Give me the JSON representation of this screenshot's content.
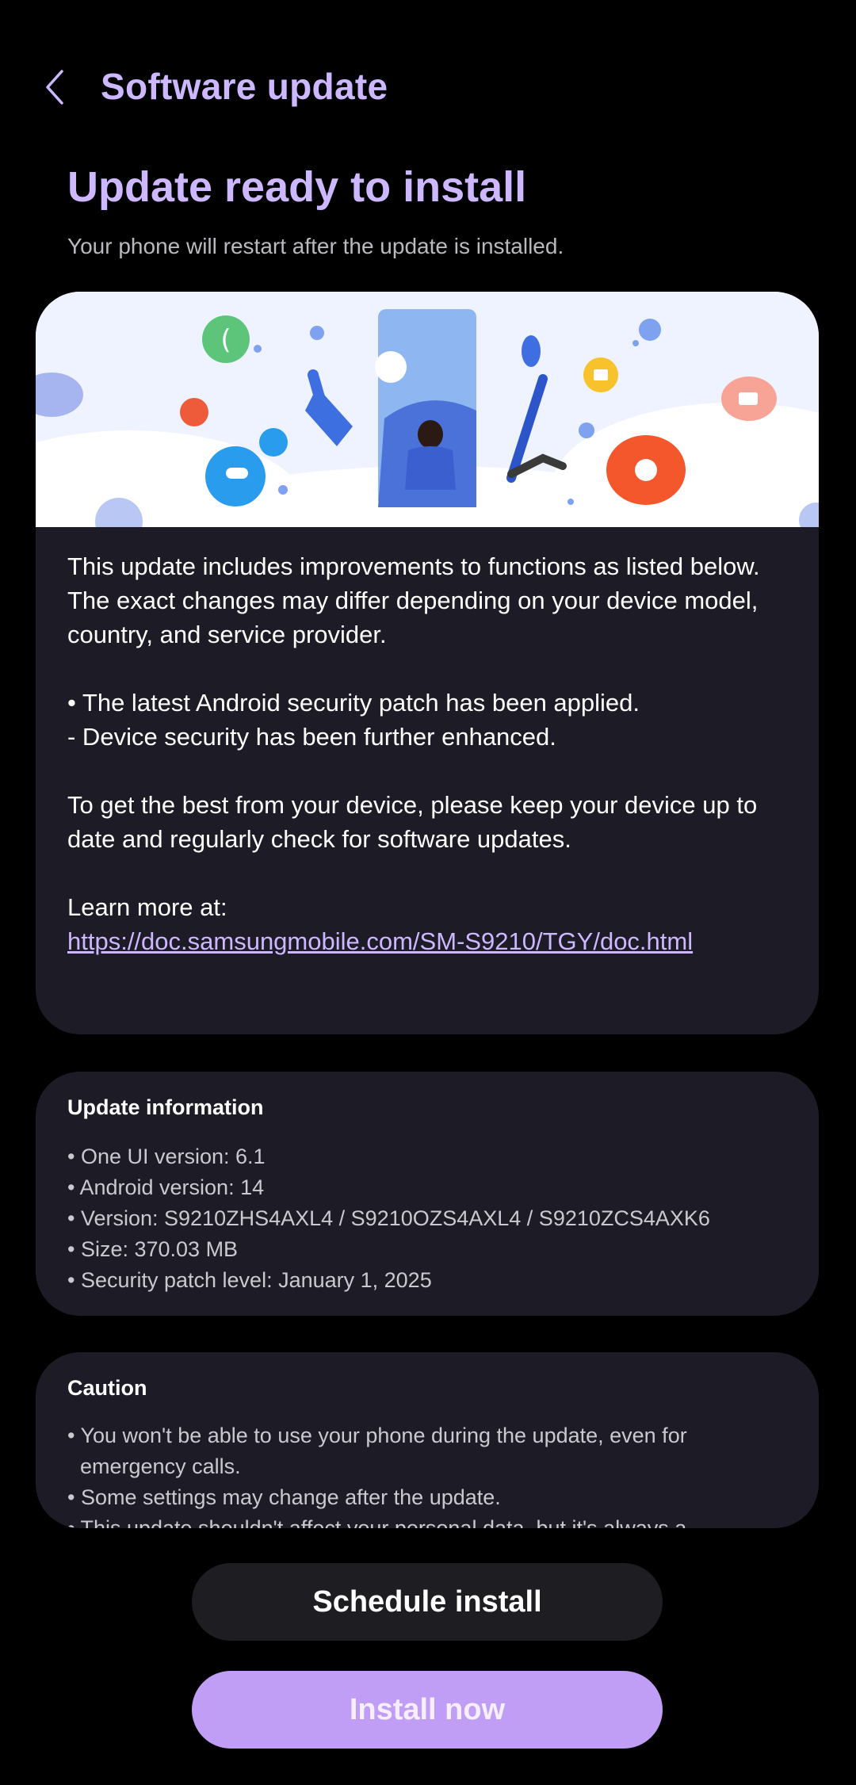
{
  "header": {
    "title": "Software update",
    "back_icon": "chevron-left-icon"
  },
  "headline": "Update ready to install",
  "subhead": "Your phone will restart after the update is installed.",
  "colors": {
    "accent": "#cdb7ff",
    "card_bg": "#1d1b26",
    "install_button": "#c09ef5"
  },
  "release_notes": {
    "intro_1": "This update includes improvements to functions as listed below.",
    "intro_2": "The exact changes may differ depending on your device model, country, and service provider.",
    "bullet_1": "• The latest Android security patch has been applied.",
    "bullet_2": "- Device security has been further enhanced.",
    "advice": "To get the best from your device, please keep your device up to date and regularly check for software updates.",
    "learn_more": "Learn more at:",
    "link": "https://doc.samsungmobile.com/SM-S9210/TGY/doc.html"
  },
  "update_info": {
    "title": "Update information",
    "items": [
      "• One UI version: 6.1",
      "• Android version: 14",
      "• Version: S9210ZHS4AXL4 / S9210OZS4AXL4 / S9210ZCS4AXK6",
      "• Size: 370.03 MB",
      "• Security patch level: January 1, 2025"
    ]
  },
  "caution": {
    "title": "Caution",
    "items": [
      "• You won't be able to use your phone during the update, even for emergency calls.",
      "• Some settings may change after the update.",
      "• This update shouldn't affect your personal data, but it's always a"
    ]
  },
  "buttons": {
    "schedule": "Schedule install",
    "install": "Install now"
  }
}
